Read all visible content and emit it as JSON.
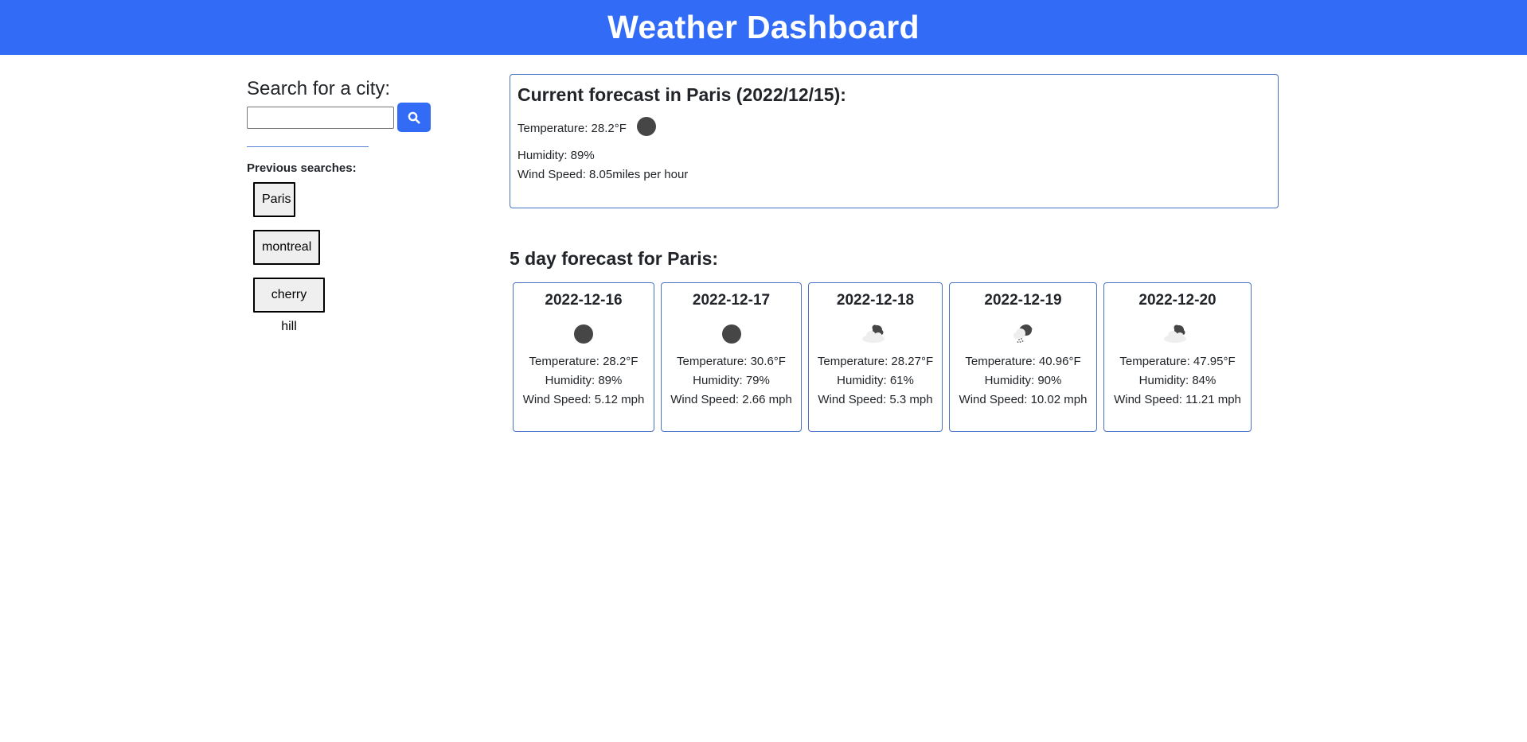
{
  "header": {
    "title": "Weather Dashboard"
  },
  "sidebar": {
    "search_label": "Search for a city:",
    "search_value": "",
    "search_placeholder": "",
    "search_button_icon": "search-icon",
    "previous_title": "Previous searches:",
    "previous": [
      "Paris",
      "montreal",
      "cherry hill"
    ]
  },
  "current": {
    "title": "Current forecast in Paris (2022/12/15):",
    "temperature": "Temperature: 28.2°F",
    "icon": "moon-icon",
    "humidity": "Humidity: 89%",
    "wind": "Wind Speed: 8.05miles per hour"
  },
  "forecast": {
    "title": "5 day forecast for Paris:",
    "days": [
      {
        "date": "2022-12-16",
        "icon": "moon-icon",
        "temperature": "Temperature: 28.2°F",
        "humidity": "Humidity: 89%",
        "wind": "Wind Speed: 5.12 mph"
      },
      {
        "date": "2022-12-17",
        "icon": "moon-icon",
        "temperature": "Temperature: 30.6°F",
        "humidity": "Humidity: 79%",
        "wind": "Wind Speed: 2.66 mph"
      },
      {
        "date": "2022-12-18",
        "icon": "cloudy-night-icon",
        "temperature": "Temperature: 28.27°F",
        "humidity": "Humidity: 61%",
        "wind": "Wind Speed: 5.3 mph"
      },
      {
        "date": "2022-12-19",
        "icon": "snow-night-icon",
        "temperature": "Temperature: 40.96°F",
        "humidity": "Humidity: 90%",
        "wind": "Wind Speed: 10.02 mph"
      },
      {
        "date": "2022-12-20",
        "icon": "cloudy-night-icon",
        "temperature": "Temperature: 47.95°F",
        "humidity": "Humidity: 84%",
        "wind": "Wind Speed: 11.21 mph"
      }
    ]
  },
  "colors": {
    "brand": "#326cf6",
    "card_border": "#4a72c4"
  }
}
